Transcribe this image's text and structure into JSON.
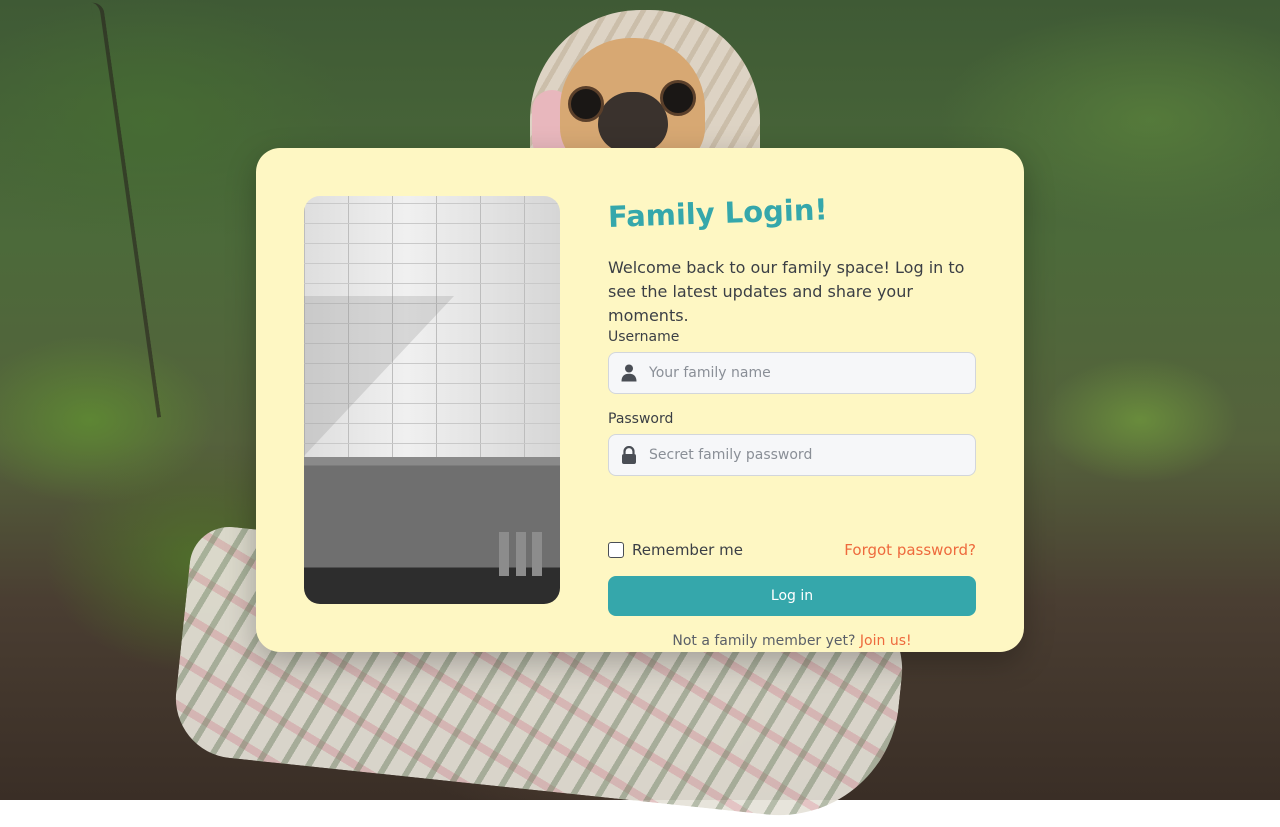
{
  "background": {
    "description_icon": "pug-in-blanket-photo"
  },
  "login_card": {
    "title": "Family Login!",
    "subtitle": "Welcome back to our family space! Log in to see the latest updates and share your moments.",
    "username": {
      "label": "Username",
      "placeholder": "Your family name",
      "value": "",
      "icon": "user-icon"
    },
    "password": {
      "label": "Password",
      "placeholder": "Secret family password",
      "value": "",
      "icon": "lock-icon"
    },
    "remember_label": "Remember me",
    "remember_checked": false,
    "forgot_label": "Forgot password?",
    "submit_label": "Log in",
    "signup_prompt": "Not a family member yet?",
    "signup_link": "Join us!"
  },
  "colors": {
    "card_background": "#fef7c3",
    "accent_teal": "#35a7ab",
    "link_orange": "#ee6a3d"
  }
}
